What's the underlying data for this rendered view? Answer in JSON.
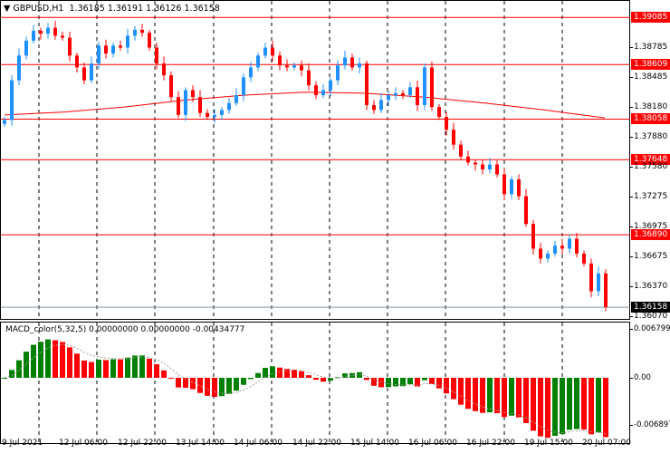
{
  "header": {
    "symbol": "GBPUSD,H1",
    "open": "1.36185",
    "high": "1.36191",
    "low": "1.36126",
    "close": "1.36158"
  },
  "macd": {
    "title": "MACD_color(5,32,5)",
    "v1": "0.00000000",
    "v2": "0.00000000",
    "v3": "-0.00434777",
    "axis": [
      "0.0067995",
      "0.00",
      "-0.006897"
    ]
  },
  "price_axis": [
    "1.38785",
    "1.38485",
    "1.38180",
    "1.37880",
    "1.37580",
    "1.37275",
    "1.36975",
    "1.36675",
    "1.36370",
    "1.36070"
  ],
  "levels": [
    "1.39085",
    "1.38609",
    "1.38058",
    "1.37648",
    "1.36890"
  ],
  "current_price": "1.36158",
  "dates": [
    "9 Jul 2021",
    "12 Jul 06:00",
    "12 Jul 22:00",
    "13 Jul 14:00",
    "14 Jul 06:00",
    "14 Jul 22:00",
    "15 Jul 14:00",
    "16 Jul 06:00",
    "16 Jul 22:00",
    "19 Jul 15:00",
    "20 Jul 07:00"
  ],
  "colors": {
    "bull": "#1e90ff",
    "bear": "#ff0000",
    "level": "#ff0000",
    "ma": "#ff0000",
    "hist_up": "#008000",
    "hist_down": "#ff0000"
  },
  "chart_data": {
    "type": "candlestick",
    "closes": [
      1.3805,
      1.3845,
      1.387,
      1.3885,
      1.3895,
      1.3892,
      1.3898,
      1.389,
      1.3888,
      1.387,
      1.3858,
      1.3845,
      1.3862,
      1.388,
      1.3872,
      1.388,
      1.3878,
      1.389,
      1.3896,
      1.3893,
      1.3878,
      1.3862,
      1.385,
      1.3828,
      1.381,
      1.3835,
      1.3828,
      1.3812,
      1.3808,
      1.381,
      1.3815,
      1.3822,
      1.383,
      1.3848,
      1.3858,
      1.387,
      1.3878,
      1.387,
      1.386,
      1.3858,
      1.386,
      1.3855,
      1.384,
      1.383,
      1.3835,
      1.3845,
      1.386,
      1.3868,
      1.3858,
      1.3862,
      1.382,
      1.3815,
      1.3825,
      1.383,
      1.3832,
      1.383,
      1.3838,
      1.382,
      1.3858,
      1.3818,
      1.3808,
      1.3795,
      1.378,
      1.3768,
      1.3762,
      1.376,
      1.3755,
      1.376,
      1.375,
      1.373,
      1.3745,
      1.3728,
      1.37,
      1.3675,
      1.3665,
      1.367,
      1.3678,
      1.3675,
      1.3685,
      1.367,
      1.366,
      1.3632,
      1.365,
      1.3616
    ],
    "ma": [
      1.381,
      1.3813,
      1.3818,
      1.3825,
      1.383,
      1.3833,
      1.3832,
      1.3828,
      1.3822,
      1.3815,
      1.3807
    ],
    "ylim": [
      1.36,
      1.3925
    ]
  }
}
